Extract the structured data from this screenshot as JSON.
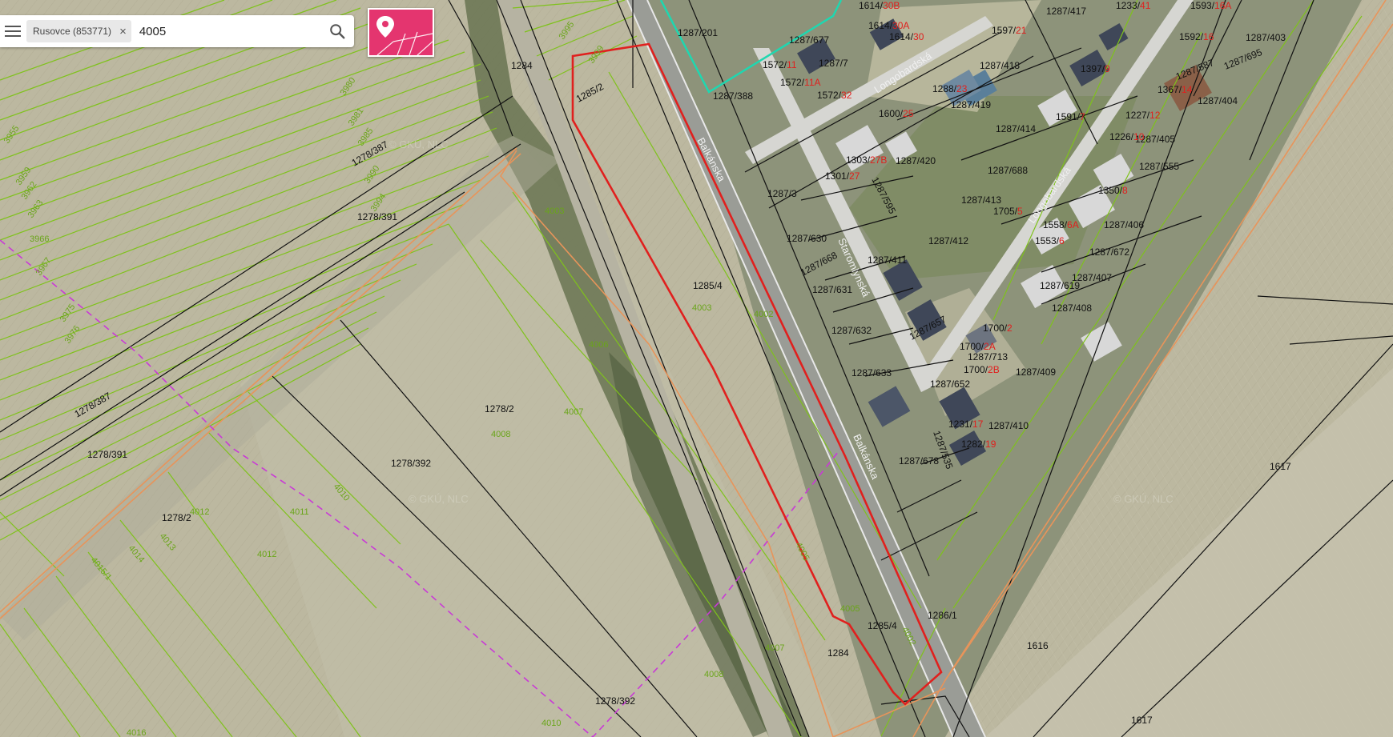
{
  "search": {
    "chip_label": "Rusovce (853771)",
    "chip_close": "×",
    "query": "4005",
    "icon": "search-icon"
  },
  "menu": {
    "icon": "hamburger-menu-icon"
  },
  "locate": {
    "icon": "location-pin-parcel-icon"
  },
  "colors": {
    "green_boundary": "#7fc21b",
    "black_boundary": "#111111",
    "orange_boundary": "#e8945a",
    "selected_parcel": "#e0201e",
    "cyan_boundary": "#1fd7b0",
    "dashed_magenta": "#c93ad6",
    "accent_button": "#e4356f"
  },
  "map": {
    "watermark": "© GKÚ, NLC",
    "streets": {
      "balkanska_1": "Balkánska",
      "balkanska_2": "Balkánska",
      "longobardska_1": "Longobardská",
      "longobardska_2": "Longobardská",
      "staromlynska": "Staromlynská"
    },
    "labels": {
      "p1284": "1284",
      "p1285_2": "1285/2",
      "p1278_387a": "1278/387",
      "p1278_391a": "1278/391",
      "p1278_387b": "1278/387",
      "p1278_391b": "1278/391",
      "p1278_2a": "1278/2",
      "p1278_392a": "1278/392",
      "p1278_2b": "1278/2",
      "p1285_4a": "1285/4",
      "p1285_4b": "1285/4",
      "p1284b": "1284",
      "p1278_392b": "1278/392",
      "p1286_1": "1286/1",
      "p1616": "1616",
      "p1617a": "1617",
      "p1617b": "1617",
      "p1287_201": "1287/201",
      "p1287_388": "1287/388",
      "p1287_3": "1287/3",
      "p1287_630": "1287/630",
      "p1287_668": "1287/668",
      "p1287_631": "1287/631",
      "p1287_632": "1287/632",
      "p1287_633": "1287/633",
      "p1287_677": "1287/677",
      "p1287_7": "1287/7",
      "p1287_420": "1287/420",
      "p1287_411": "1287/411",
      "p1287_412": "1287/412",
      "p1287_413": "1287/413",
      "p1287_414": "1287/414",
      "p1287_418": "1287/418",
      "p1287_417": "1287/417",
      "p1287_419": "1287/419",
      "p1287_688": "1287/688",
      "p1287_403": "1287/403",
      "p1287_404": "1287/404",
      "p1287_405": "1287/405",
      "p1287_555": "1287/555",
      "p1287_406": "1287/406",
      "p1287_672": "1287/672",
      "p1287_407": "1287/407",
      "p1287_619": "1287/619",
      "p1287_408": "1287/408",
      "p1287_409": "1287/409",
      "p1287_410": "1287/410",
      "p1287_713": "1287/713",
      "p1287_678": "1287/678",
      "p1287_652": "1287/652",
      "p1287_657": "1287/657",
      "p1287_595": "1287/595",
      "p1287_695": "1287/695",
      "p1287_587": "1287/587",
      "p1287_535": "1287/535"
    },
    "green_labels": {
      "g4003a": "4003",
      "g4003b": "4003",
      "g4006": "4006",
      "g4007a": "4007",
      "g4008a": "4008",
      "g4002": "4002",
      "g4005a": "4005",
      "g4005b": "4005",
      "g4002b": "4002",
      "g4007b": "4007",
      "g4008b": "4008",
      "g4010a": "4010",
      "g4010b": "4010",
      "g4011": "4011",
      "g4012a": "4012",
      "g4012b": "4012",
      "g4013": "4013",
      "g4014": "4014",
      "g4015_1": "4015/1",
      "g4016": "4016",
      "g3966": "3966",
      "g3967": "3967",
      "g3975": "3975",
      "g3976": "3976",
      "g3980": "3980",
      "g3981": "3981",
      "g3985": "3985",
      "g3990": "3990",
      "g3994": "3994",
      "g3995": "3995",
      "g3999": "3999",
      "g3955": "3955",
      "g3959": "3959",
      "g3962": "3962",
      "g3963": "3963"
    },
    "addresses": [
      {
        "base": "1614/",
        "num": "30B"
      },
      {
        "base": "1614/",
        "num": "30A"
      },
      {
        "base": "1614/",
        "num": "30"
      },
      {
        "base": "1572/",
        "num": "11"
      },
      {
        "base": "1572/",
        "num": "11A"
      },
      {
        "base": "1572/",
        "num": "32"
      },
      {
        "base": "1597/",
        "num": "21"
      },
      {
        "base": "1233/",
        "num": "41"
      },
      {
        "base": "1593/",
        "num": "16A"
      },
      {
        "base": "1592/",
        "num": "16"
      },
      {
        "base": "1397/",
        "num": "9"
      },
      {
        "base": "1367/",
        "num": "14"
      },
      {
        "base": "1288/",
        "num": "23"
      },
      {
        "base": "1600/",
        "num": "25"
      },
      {
        "base": "1591/",
        "num": "7"
      },
      {
        "base": "1227/",
        "num": "12"
      },
      {
        "base": "1226/",
        "num": "10"
      },
      {
        "base": "1303/",
        "num": "27B"
      },
      {
        "base": "1301/",
        "num": "27"
      },
      {
        "base": "1350/",
        "num": "8"
      },
      {
        "base": "1705/",
        "num": "5"
      },
      {
        "base": "1558/",
        "num": "6A"
      },
      {
        "base": "1553/",
        "num": "6"
      },
      {
        "base": "1700/",
        "num": "2"
      },
      {
        "base": "1700/",
        "num": "2A"
      },
      {
        "base": "1700/",
        "num": "2B"
      },
      {
        "base": "1231/",
        "num": "17"
      },
      {
        "base": "1282/",
        "num": "19"
      }
    ]
  }
}
